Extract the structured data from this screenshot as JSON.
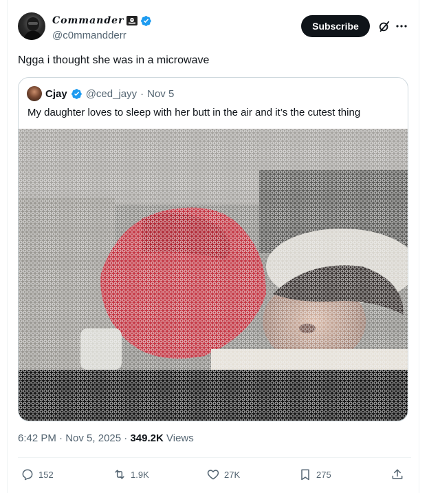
{
  "author": {
    "display_name": "Commander",
    "handle": "@c0mmandderr"
  },
  "header": {
    "subscribe_label": "Subscribe"
  },
  "tweet": {
    "text": "Ngga i thought she was in a microwave"
  },
  "quote": {
    "name": "Cjay",
    "handle": "@ced_jayy",
    "dot": "·",
    "date": "Nov 5",
    "text": "My daughter loves to sleep with her butt in the air and it’s the cutest thing"
  },
  "meta": {
    "time": "6:42 PM",
    "date": "Nov 5, 2025",
    "views_count": "349.2K",
    "views_label": "Views"
  },
  "actions": {
    "replies": "152",
    "reposts": "1.9K",
    "likes": "27K",
    "bookmarks": "275"
  },
  "colors": {
    "verified": "#1d9bf0",
    "text_primary": "#0f1419",
    "text_secondary": "#536471",
    "border": "#cfd9de"
  }
}
